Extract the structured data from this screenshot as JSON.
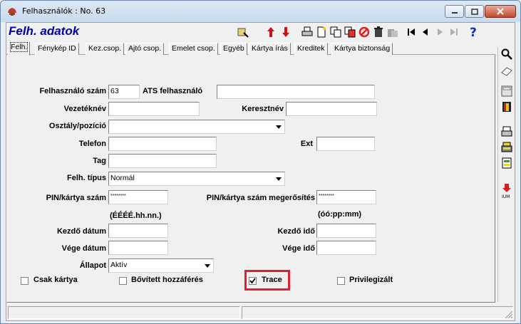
{
  "window": {
    "title": "Felhasználók : No. 63"
  },
  "header": {
    "title": "Felh. adatok"
  },
  "tabs": [
    {
      "label": "Felh."
    },
    {
      "label": "Fénykép ID"
    },
    {
      "label": "Kez.csop."
    },
    {
      "label": "Ajtó csop."
    },
    {
      "label": "Emelet csop."
    },
    {
      "label": "Egyéb"
    },
    {
      "label": "Kártya írás"
    },
    {
      "label": "Kreditek"
    },
    {
      "label": "Kártya biztonság"
    }
  ],
  "form": {
    "user_number_label": "Felhasználó szám",
    "user_number_value": "63",
    "ats_user_label": "ATS felhasználó",
    "ats_user_value": "",
    "lastname_label": "Vezetéknév",
    "lastname_value": "",
    "firstname_label": "Keresztnév",
    "firstname_value": "",
    "department_label": "Osztály/pozíció",
    "department_value": "",
    "phone_label": "Telefon",
    "phone_value": "",
    "ext_label": "Ext",
    "ext_value": "",
    "member_label": "Tag",
    "member_value": "",
    "user_type_label": "Felh. típus",
    "user_type_value": "Normál",
    "pin_label": "PIN/kártya szám",
    "pin_value": "********",
    "pin_confirm_label": "PIN/kártya szám megerősítés",
    "pin_confirm_value": "********",
    "date_format_hint": "(ÉÉÉÉ.hh.nn.)",
    "time_format_hint": "(óó:pp:mm)",
    "start_date_label": "Kezdő dátum",
    "start_date_value": "",
    "start_time_label": "Kezdő idő",
    "start_time_value": "",
    "end_date_label": "Vége dátum",
    "end_date_value": "",
    "end_time_label": "Vége idő",
    "end_time_value": "",
    "state_label": "Állapot",
    "state_value": "Aktív"
  },
  "checkboxes": {
    "card_only": {
      "label": "Csak kártya",
      "checked": false
    },
    "extended_access": {
      "label": "Bővített hozzáférés",
      "checked": false
    },
    "trace": {
      "label": "Trace",
      "checked": true
    },
    "privileged": {
      "label": "Privilegizált",
      "checked": false
    }
  },
  "colors": {
    "header_title": "#0000a8",
    "highlight_border": "#e0202a"
  }
}
